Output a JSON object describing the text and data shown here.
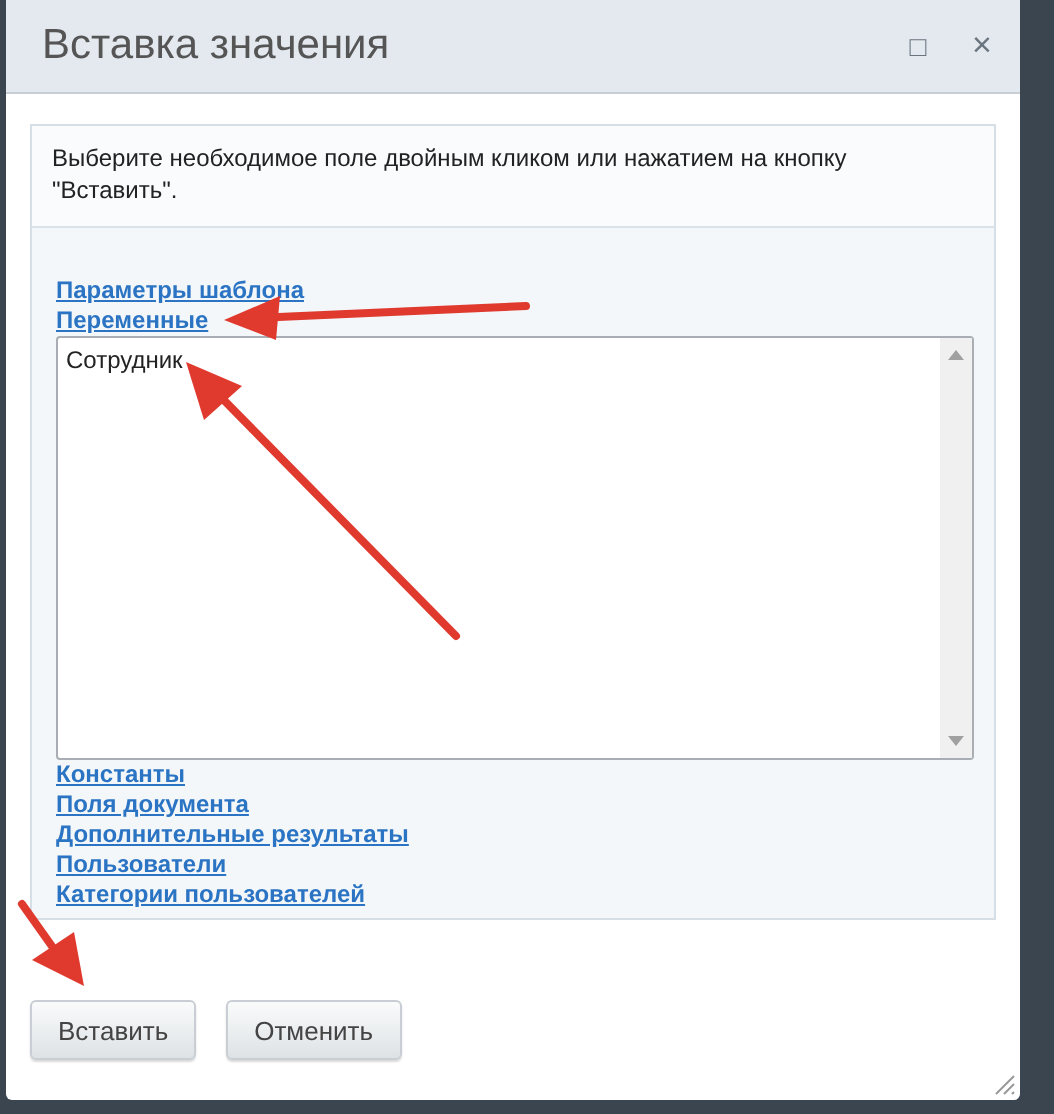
{
  "window": {
    "title": "Вставка значения",
    "controls": [
      "□",
      "×"
    ]
  },
  "hint": "Выберите необходимое поле двойным кликом или нажатием на кнопку \"Вставить\".",
  "groups_above": [
    "Параметры шаблона",
    "Переменные"
  ],
  "list": {
    "items": [
      "Сотрудник"
    ]
  },
  "groups_below": [
    "Константы",
    "Поля документа",
    "Дополнительные результаты",
    "Пользователи",
    "Категории пользователей"
  ],
  "buttons": [
    "Вставить",
    "Отменить"
  ]
}
